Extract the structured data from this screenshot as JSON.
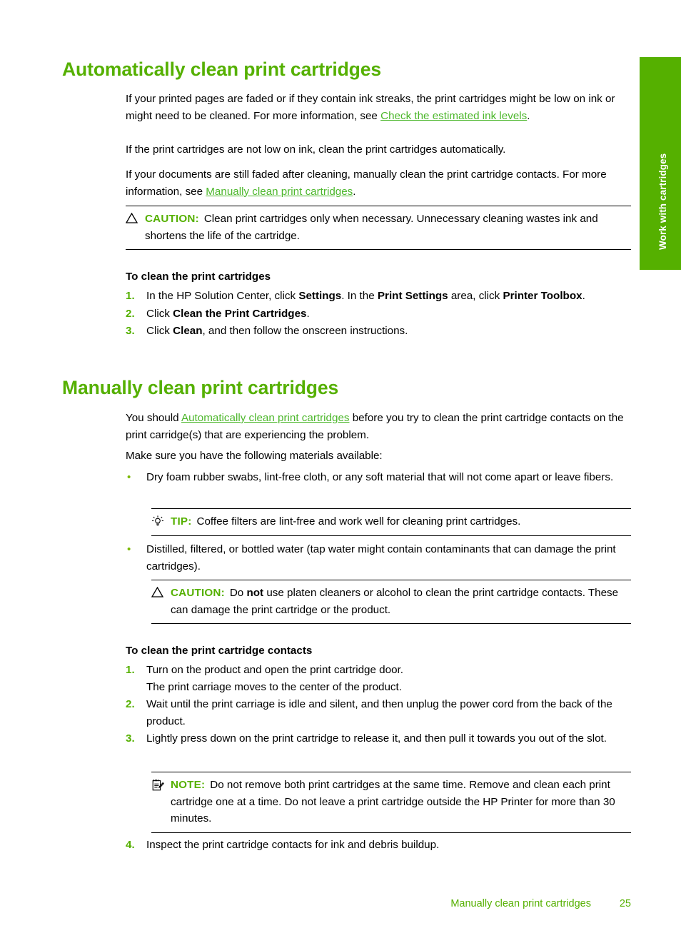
{
  "side_tab": {
    "label": "Work with cartridges",
    "color": "#55b000"
  },
  "colors": {
    "heading_green": "#55b000",
    "link_green": "#4cb72b",
    "bullet_green": "#7ab800"
  },
  "sections": [
    {
      "heading": "Automatically clean print cartridges",
      "paragraphs": [
        {
          "parts": [
            {
              "type": "text",
              "value": "If your printed pages are faded or if they contain ink streaks, the print cartridges might be low on ink or might need to be cleaned. For more information, see "
            },
            {
              "type": "link",
              "value": "Check the estimated ink levels"
            },
            {
              "type": "text",
              "value": "."
            }
          ]
        },
        {
          "parts": [
            {
              "type": "text",
              "value": "If the print cartridges are not low on ink, clean the print cartridges automatically."
            }
          ]
        },
        {
          "parts": [
            {
              "type": "text",
              "value": "If your documents are still faded after cleaning, manually clean the print cartridge contacts. For more information, see "
            },
            {
              "type": "link",
              "value": "Manually clean print cartridges"
            },
            {
              "type": "text",
              "value": "."
            }
          ]
        }
      ],
      "caution": {
        "icon": "caution-triangle-icon",
        "keyword": "CAUTION:",
        "text": "Clean print cartridges only when necessary. Unnecessary cleaning wastes ink and shortens the life of the cartridge."
      },
      "procedure": {
        "title": "To clean the print cartridges",
        "steps": [
          {
            "number": "1.",
            "parts": [
              {
                "type": "text",
                "value": "In the HP Solution Center, click "
              },
              {
                "type": "bold",
                "value": "Settings"
              },
              {
                "type": "text",
                "value": ". In the "
              },
              {
                "type": "bold",
                "value": "Print Settings"
              },
              {
                "type": "text",
                "value": " area, click "
              },
              {
                "type": "bold",
                "value": "Printer Toolbox"
              },
              {
                "type": "text",
                "value": "."
              }
            ]
          },
          {
            "number": "2.",
            "parts": [
              {
                "type": "text",
                "value": "Click "
              },
              {
                "type": "bold",
                "value": "Clean the Print Cartridges"
              },
              {
                "type": "text",
                "value": "."
              }
            ]
          },
          {
            "number": "3.",
            "parts": [
              {
                "type": "text",
                "value": "Click "
              },
              {
                "type": "bold",
                "value": "Clean"
              },
              {
                "type": "text",
                "value": ", and then follow the onscreen instructions."
              }
            ]
          }
        ]
      }
    },
    {
      "heading": "Manually clean print cartridges",
      "intro": {
        "parts": [
          {
            "type": "text",
            "value": "You should "
          },
          {
            "type": "link",
            "value": "Automatically clean print cartridges"
          },
          {
            "type": "text",
            "value": " before you try to clean the print cartridge contacts on the print carridge(s) that are experiencing the problem."
          }
        ]
      },
      "materials_lead": "Make sure you have the following materials available:",
      "bullet_1": "Dry foam rubber swabs, lint-free cloth, or any soft material that will not come apart or leave fibers.",
      "tip": {
        "icon": "lightbulb-tip-icon",
        "keyword": "TIP:",
        "text": "Coffee filters are lint-free and work well for cleaning print cartridges."
      },
      "bullet_2": "Distilled, filtered, or bottled water (tap water might contain contaminants that can damage the print cartridges).",
      "caution": {
        "icon": "caution-triangle-icon",
        "keyword": "CAUTION:",
        "parts": [
          {
            "type": "text",
            "value": "Do "
          },
          {
            "type": "bold",
            "value": "not"
          },
          {
            "type": "text",
            "value": " use platen cleaners or alcohol to clean the print cartridge contacts. These can damage the print cartridge or the product."
          }
        ]
      },
      "procedure": {
        "title": "To clean the print cartridge contacts",
        "steps": [
          {
            "number": "1.",
            "text": "Turn on the product and open the print cartridge door.",
            "substep": "The print carriage moves to the center of the product."
          },
          {
            "number": "2.",
            "text": "Wait until the print carriage is idle and silent, and then unplug the power cord from the back of the product."
          },
          {
            "number": "3.",
            "text": "Lightly press down on the print cartridge to release it, and then pull it towards you out of the slot."
          },
          {
            "number": "4.",
            "text": "Inspect the print cartridge contacts for ink and debris buildup."
          }
        ]
      },
      "note": {
        "icon": "note-pad-icon",
        "keyword": "NOTE:",
        "text": "Do not remove both print cartridges at the same time. Remove and clean each print cartridge one at a time. Do not leave a print cartridge outside the HP Printer for more than 30 minutes."
      }
    }
  ],
  "footer": {
    "title": "Manually clean print cartridges",
    "page_number": "25"
  }
}
